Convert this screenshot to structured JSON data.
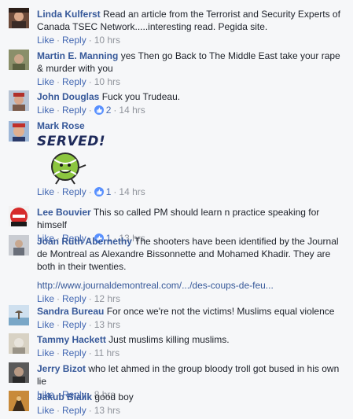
{
  "actions": {
    "like": "Like",
    "reply": "Reply",
    "sep": "·"
  },
  "comments": [
    {
      "author": "Linda Kulferst",
      "text": "Read an article from the Terrorist and Security Experts of Canada TSEC Network.....interesting read. Pegida site.",
      "time": "10 hrs"
    },
    {
      "author": "Martin E. Manning",
      "text": "yes Then go Back to The Middle East take your rape & murder with you",
      "time": "10 hrs"
    },
    {
      "author": "John Douglas",
      "text": "Fuck you Trudeau.",
      "reactions": "2",
      "time": "14 hrs"
    },
    {
      "author": "Mark Rose",
      "sticker_text": "SERVED!",
      "reactions": "1",
      "time": "14 hrs"
    },
    {
      "author": "Lee Bouvier",
      "text": "This so called PM should learn n practice speaking for himself",
      "reactions": "1",
      "time": "13 hrs"
    },
    {
      "author": "Joan Ruth Abernethy",
      "text": "The shooters have been identified by the Journal de Montreal as Alexandre Bissonnette and Mohamed Khadir. They are both in their twenties.",
      "link": "http://www.journaldemontreal.com/.../des-coups-de-feu...",
      "time": "12 hrs"
    },
    {
      "author": "Sandra Bureau",
      "text": "For once we're not the victims! Muslims equal violence",
      "time": "13 hrs"
    },
    {
      "author": "Tammy Hackett",
      "text": "Just muslims killing muslims.",
      "time": "11 hrs"
    },
    {
      "author": "Jerry Bizot",
      "text": "who let ahmed in the group bloody troll got bused in his own lie",
      "time": "8 hrs"
    },
    {
      "author": "Jakub Bialik",
      "text": "good boy",
      "time": "13 hrs"
    }
  ],
  "colors": {
    "author": "#365899",
    "link": "#4267b2",
    "meta": "#90949c",
    "like_badge": "#5890ff"
  }
}
